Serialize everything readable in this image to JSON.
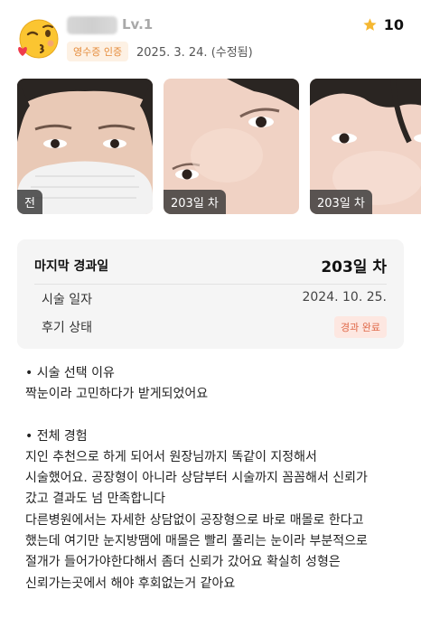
{
  "header": {
    "level": "Lv.1",
    "receipt_badge": "영수증 인증",
    "date": "2025. 3. 24. (수정됨)",
    "rating": "10",
    "accent": "#f5b731"
  },
  "photos": [
    {
      "tag": "전"
    },
    {
      "tag": "203일 차"
    },
    {
      "tag": "203일 차"
    }
  ],
  "summary": {
    "last_label": "마지막 경과일",
    "last_value": "203일 차",
    "procedure_label": "시술 일자",
    "procedure_value": "2024. 10. 25.",
    "status_label": "후기 상태",
    "status_value": "경과 완료"
  },
  "review": {
    "section1_title": "• 시술 선택 이유",
    "section1_body": "짝눈이라 고민하다가 받게되었어요",
    "section2_title": "• 전체 경험",
    "lines": [
      "지인 추천으로 하게 되어서 원장님까지 똑같이 지정해서",
      "시술했어요. 공장형이 아니라 상담부터 시술까지 꼼꼼해서 신뢰가",
      "갔고 결과도 넘 만족합니다",
      "다른병원에서는 자세한 상담없이 공장형으로 바로 매몰로 한다고",
      "했는데 여기만 눈지방땜에 매몰은 빨리 풀리는 눈이라 부분적으로",
      "절개가 들어가야한다해서 좀더 신뢰가 갔어요 확실히 성형은",
      "신뢰가는곳에서 해야 후회없는거 같아요"
    ]
  }
}
